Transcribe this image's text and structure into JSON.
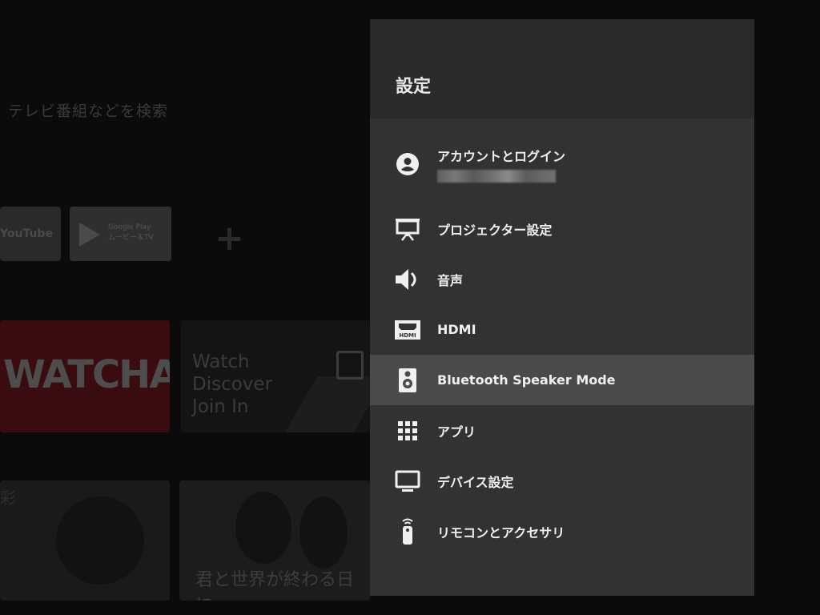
{
  "background": {
    "search_hint": "テレビ番組などを検索",
    "apps": [
      {
        "label": "YouTube"
      },
      {
        "label": "Google Play",
        "sublabel": "ムービー＆TV"
      }
    ],
    "featured": {
      "watcha_label": "WATCHA",
      "twitch_lines": [
        "Watch",
        "Discover",
        "Join In"
      ]
    },
    "movies": [
      {
        "title": "彩"
      },
      {
        "title": "君と世界が終わる日に"
      }
    ]
  },
  "settings": {
    "title": "設定",
    "items": [
      {
        "label": "アカウントとログイン",
        "icon": "account-circle-icon"
      },
      {
        "label": "プロジェクター設定",
        "icon": "projector-screen-icon"
      },
      {
        "label": "音声",
        "icon": "speaker-volume-icon"
      },
      {
        "label": "HDMI",
        "icon": "hdmi-icon"
      },
      {
        "label": "Bluetooth Speaker Mode",
        "icon": "speaker-box-icon",
        "selected": true
      },
      {
        "label": "アプリ",
        "icon": "apps-grid-icon"
      },
      {
        "label": "デバイス設定",
        "icon": "tv-monitor-icon"
      },
      {
        "label": "リモコンとアクセサリ",
        "icon": "remote-control-icon"
      }
    ]
  },
  "colors": {
    "panel_bg": "#323232",
    "header_bg": "#2b2b2b",
    "selected_bg": "#4a4a4a",
    "text": "#f0f0f0"
  }
}
